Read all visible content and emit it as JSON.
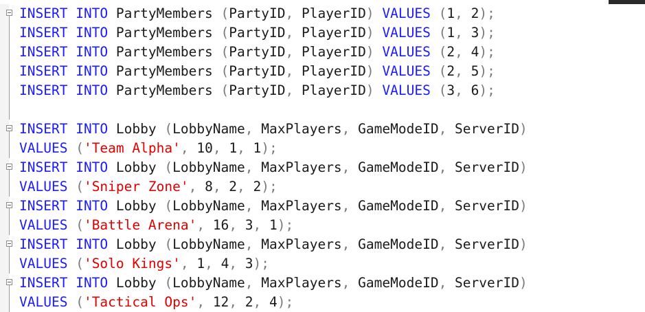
{
  "lines": [
    {
      "t": [
        [
          "kw",
          "INSERT"
        ],
        [
          "txt",
          " "
        ],
        [
          "kw",
          "INTO"
        ],
        [
          "txt",
          " PartyMembers "
        ],
        [
          "punc",
          "("
        ],
        [
          "txt",
          "PartyID"
        ],
        [
          "punc",
          ","
        ],
        [
          "txt",
          " PlayerID"
        ],
        [
          "punc",
          ")"
        ],
        [
          "txt",
          " "
        ],
        [
          "kw",
          "VALUES"
        ],
        [
          "txt",
          " "
        ],
        [
          "punc",
          "("
        ],
        [
          "num",
          "1"
        ],
        [
          "punc",
          ","
        ],
        [
          "num",
          " 2"
        ],
        [
          "punc",
          ")"
        ],
        [
          "punc",
          ";"
        ]
      ]
    },
    {
      "t": [
        [
          "kw",
          "INSERT"
        ],
        [
          "txt",
          " "
        ],
        [
          "kw",
          "INTO"
        ],
        [
          "txt",
          " PartyMembers "
        ],
        [
          "punc",
          "("
        ],
        [
          "txt",
          "PartyID"
        ],
        [
          "punc",
          ","
        ],
        [
          "txt",
          " PlayerID"
        ],
        [
          "punc",
          ")"
        ],
        [
          "txt",
          " "
        ],
        [
          "kw",
          "VALUES"
        ],
        [
          "txt",
          " "
        ],
        [
          "punc",
          "("
        ],
        [
          "num",
          "1"
        ],
        [
          "punc",
          ","
        ],
        [
          "num",
          " 3"
        ],
        [
          "punc",
          ")"
        ],
        [
          "punc",
          ";"
        ]
      ]
    },
    {
      "t": [
        [
          "kw",
          "INSERT"
        ],
        [
          "txt",
          " "
        ],
        [
          "kw",
          "INTO"
        ],
        [
          "txt",
          " PartyMembers "
        ],
        [
          "punc",
          "("
        ],
        [
          "txt",
          "PartyID"
        ],
        [
          "punc",
          ","
        ],
        [
          "txt",
          " PlayerID"
        ],
        [
          "punc",
          ")"
        ],
        [
          "txt",
          " "
        ],
        [
          "kw",
          "VALUES"
        ],
        [
          "txt",
          " "
        ],
        [
          "punc",
          "("
        ],
        [
          "num",
          "2"
        ],
        [
          "punc",
          ","
        ],
        [
          "num",
          " 4"
        ],
        [
          "punc",
          ")"
        ],
        [
          "punc",
          ";"
        ]
      ]
    },
    {
      "t": [
        [
          "kw",
          "INSERT"
        ],
        [
          "txt",
          " "
        ],
        [
          "kw",
          "INTO"
        ],
        [
          "txt",
          " PartyMembers "
        ],
        [
          "punc",
          "("
        ],
        [
          "txt",
          "PartyID"
        ],
        [
          "punc",
          ","
        ],
        [
          "txt",
          " PlayerID"
        ],
        [
          "punc",
          ")"
        ],
        [
          "txt",
          " "
        ],
        [
          "kw",
          "VALUES"
        ],
        [
          "txt",
          " "
        ],
        [
          "punc",
          "("
        ],
        [
          "num",
          "2"
        ],
        [
          "punc",
          ","
        ],
        [
          "num",
          " 5"
        ],
        [
          "punc",
          ")"
        ],
        [
          "punc",
          ";"
        ]
      ]
    },
    {
      "t": [
        [
          "kw",
          "INSERT"
        ],
        [
          "txt",
          " "
        ],
        [
          "kw",
          "INTO"
        ],
        [
          "txt",
          " PartyMembers "
        ],
        [
          "punc",
          "("
        ],
        [
          "txt",
          "PartyID"
        ],
        [
          "punc",
          ","
        ],
        [
          "txt",
          " PlayerID"
        ],
        [
          "punc",
          ")"
        ],
        [
          "txt",
          " "
        ],
        [
          "kw",
          "VALUES"
        ],
        [
          "txt",
          " "
        ],
        [
          "punc",
          "("
        ],
        [
          "num",
          "3"
        ],
        [
          "punc",
          ","
        ],
        [
          "num",
          " 6"
        ],
        [
          "punc",
          ")"
        ],
        [
          "punc",
          ";"
        ]
      ]
    },
    {
      "t": []
    },
    {
      "t": [
        [
          "kw",
          "INSERT"
        ],
        [
          "txt",
          " "
        ],
        [
          "kw",
          "INTO"
        ],
        [
          "txt",
          " Lobby "
        ],
        [
          "punc",
          "("
        ],
        [
          "txt",
          "LobbyName"
        ],
        [
          "punc",
          ","
        ],
        [
          "txt",
          " MaxPlayers"
        ],
        [
          "punc",
          ","
        ],
        [
          "txt",
          " GameModeID"
        ],
        [
          "punc",
          ","
        ],
        [
          "txt",
          " ServerID"
        ],
        [
          "punc",
          ")"
        ]
      ]
    },
    {
      "t": [
        [
          "kw",
          "VALUES"
        ],
        [
          "txt",
          " "
        ],
        [
          "punc",
          "("
        ],
        [
          "str",
          "'Team Alpha'"
        ],
        [
          "punc",
          ","
        ],
        [
          "num",
          " 10"
        ],
        [
          "punc",
          ","
        ],
        [
          "num",
          " 1"
        ],
        [
          "punc",
          ","
        ],
        [
          "num",
          " 1"
        ],
        [
          "punc",
          ")"
        ],
        [
          "punc",
          ";"
        ]
      ]
    },
    {
      "t": [
        [
          "kw",
          "INSERT"
        ],
        [
          "txt",
          " "
        ],
        [
          "kw",
          "INTO"
        ],
        [
          "txt",
          " Lobby "
        ],
        [
          "punc",
          "("
        ],
        [
          "txt",
          "LobbyName"
        ],
        [
          "punc",
          ","
        ],
        [
          "txt",
          " MaxPlayers"
        ],
        [
          "punc",
          ","
        ],
        [
          "txt",
          " GameModeID"
        ],
        [
          "punc",
          ","
        ],
        [
          "txt",
          " ServerID"
        ],
        [
          "punc",
          ")"
        ]
      ]
    },
    {
      "t": [
        [
          "kw",
          "VALUES"
        ],
        [
          "txt",
          " "
        ],
        [
          "punc",
          "("
        ],
        [
          "str",
          "'Sniper Zone'"
        ],
        [
          "punc",
          ","
        ],
        [
          "num",
          " 8"
        ],
        [
          "punc",
          ","
        ],
        [
          "num",
          " 2"
        ],
        [
          "punc",
          ","
        ],
        [
          "num",
          " 2"
        ],
        [
          "punc",
          ")"
        ],
        [
          "punc",
          ";"
        ]
      ]
    },
    {
      "t": [
        [
          "kw",
          "INSERT"
        ],
        [
          "txt",
          " "
        ],
        [
          "kw",
          "INTO"
        ],
        [
          "txt",
          " Lobby "
        ],
        [
          "punc",
          "("
        ],
        [
          "txt",
          "LobbyName"
        ],
        [
          "punc",
          ","
        ],
        [
          "txt",
          " MaxPlayers"
        ],
        [
          "punc",
          ","
        ],
        [
          "txt",
          " GameModeID"
        ],
        [
          "punc",
          ","
        ],
        [
          "txt",
          " ServerID"
        ],
        [
          "punc",
          ")"
        ]
      ]
    },
    {
      "t": [
        [
          "kw",
          "VALUES"
        ],
        [
          "txt",
          " "
        ],
        [
          "punc",
          "("
        ],
        [
          "str",
          "'Battle Arena'"
        ],
        [
          "punc",
          ","
        ],
        [
          "num",
          " 16"
        ],
        [
          "punc",
          ","
        ],
        [
          "num",
          " 3"
        ],
        [
          "punc",
          ","
        ],
        [
          "num",
          " 1"
        ],
        [
          "punc",
          ")"
        ],
        [
          "punc",
          ";"
        ]
      ]
    },
    {
      "t": [
        [
          "kw",
          "INSERT"
        ],
        [
          "txt",
          " "
        ],
        [
          "kw",
          "INTO"
        ],
        [
          "txt",
          " Lobby "
        ],
        [
          "punc",
          "("
        ],
        [
          "txt",
          "LobbyName"
        ],
        [
          "punc",
          ","
        ],
        [
          "txt",
          " MaxPlayers"
        ],
        [
          "punc",
          ","
        ],
        [
          "txt",
          " GameModeID"
        ],
        [
          "punc",
          ","
        ],
        [
          "txt",
          " ServerID"
        ],
        [
          "punc",
          ")"
        ]
      ]
    },
    {
      "t": [
        [
          "kw",
          "VALUES"
        ],
        [
          "txt",
          " "
        ],
        [
          "punc",
          "("
        ],
        [
          "str",
          "'Solo Kings'"
        ],
        [
          "punc",
          ","
        ],
        [
          "num",
          " 1"
        ],
        [
          "punc",
          ","
        ],
        [
          "num",
          " 4"
        ],
        [
          "punc",
          ","
        ],
        [
          "num",
          " 3"
        ],
        [
          "punc",
          ")"
        ],
        [
          "punc",
          ";"
        ]
      ]
    },
    {
      "t": [
        [
          "kw",
          "INSERT"
        ],
        [
          "txt",
          " "
        ],
        [
          "kw",
          "INTO"
        ],
        [
          "txt",
          " Lobby "
        ],
        [
          "punc",
          "("
        ],
        [
          "txt",
          "LobbyName"
        ],
        [
          "punc",
          ","
        ],
        [
          "txt",
          " MaxPlayers"
        ],
        [
          "punc",
          ","
        ],
        [
          "txt",
          " GameModeID"
        ],
        [
          "punc",
          ","
        ],
        [
          "txt",
          " ServerID"
        ],
        [
          "punc",
          ")"
        ]
      ]
    },
    {
      "t": [
        [
          "kw",
          "VALUES"
        ],
        [
          "txt",
          " "
        ],
        [
          "punc",
          "("
        ],
        [
          "str",
          "'Tactical Ops'"
        ],
        [
          "punc",
          ","
        ],
        [
          "num",
          " 12"
        ],
        [
          "punc",
          ","
        ],
        [
          "num",
          " 2"
        ],
        [
          "punc",
          ","
        ],
        [
          "num",
          " 4"
        ],
        [
          "punc",
          ")"
        ],
        [
          "punc",
          ";"
        ]
      ]
    }
  ],
  "colors": {
    "keyword": "#1b1bff",
    "string": "#e00000",
    "punctuation": "#7a7a7a",
    "text": "#1a1a1a"
  }
}
